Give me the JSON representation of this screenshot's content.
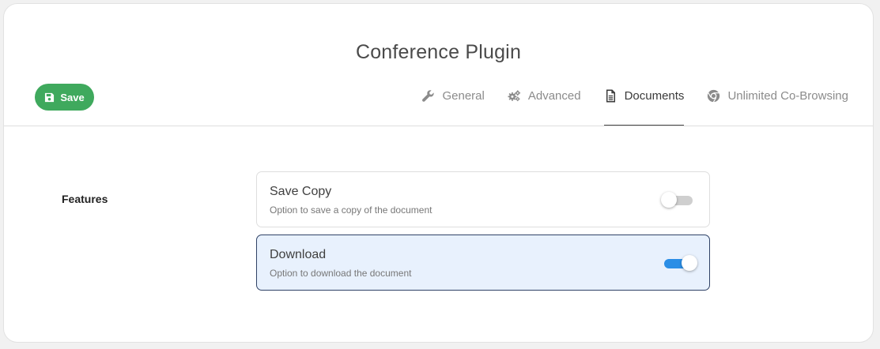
{
  "page": {
    "title": "Conference Plugin"
  },
  "toolbar": {
    "save_label": "Save",
    "save_icon": "floppy-disk-icon",
    "save_color": "#3fa95d"
  },
  "tabs": [
    {
      "label": "General",
      "icon": "wrench-icon",
      "active": false
    },
    {
      "label": "Advanced",
      "icon": "gears-icon",
      "active": false
    },
    {
      "label": "Documents",
      "icon": "document-icon",
      "active": true
    },
    {
      "label": "Unlimited Co-Browsing",
      "icon": "chrome-icon",
      "active": false
    }
  ],
  "features": {
    "label": "Features",
    "options": [
      {
        "title": "Save Copy",
        "description": "Option to save a copy of the document",
        "enabled": false,
        "selected": false
      },
      {
        "title": "Download",
        "description": "Option to download the document",
        "enabled": true,
        "selected": true
      }
    ]
  },
  "colors": {
    "toggle_on": "#2b8ee6",
    "toggle_off": "#cfcfcf",
    "selected_bg": "#e8f1fd",
    "selected_border": "#2f4266"
  }
}
